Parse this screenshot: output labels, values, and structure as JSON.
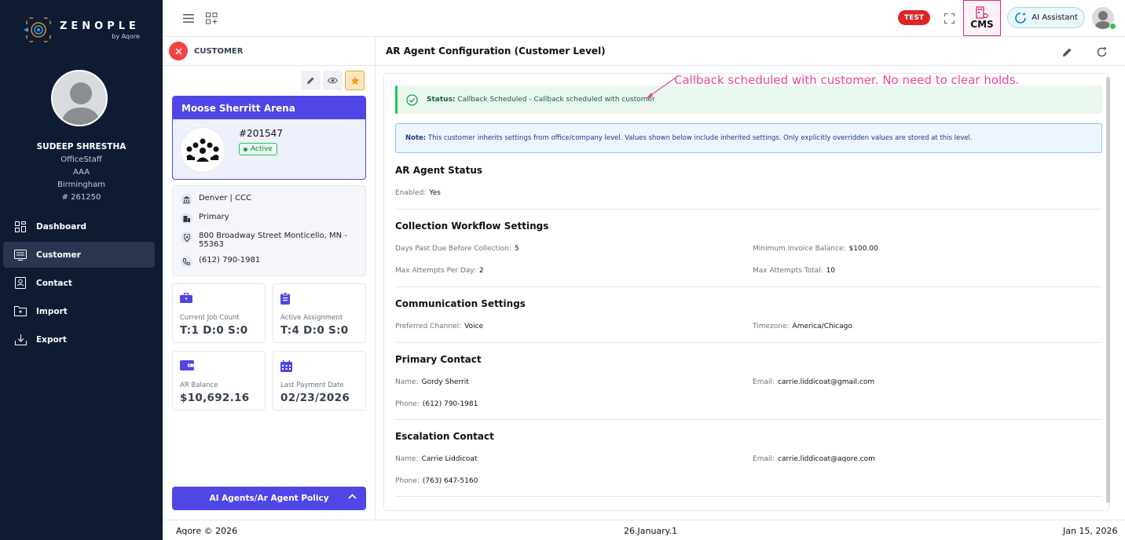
{
  "brand": {
    "name": "ZENOPLE",
    "sub": "by Aqore"
  },
  "user": {
    "name": "SUDEEP SHRESTHA",
    "role": "OfficeStaff",
    "group": "AAA",
    "location": "Birmingham",
    "id": "# 261250"
  },
  "nav": {
    "items": [
      {
        "label": "Dashboard",
        "icon": "dashboard-icon"
      },
      {
        "label": "Customer",
        "icon": "customer-icon",
        "active": true
      },
      {
        "label": "Contact",
        "icon": "contact-icon"
      },
      {
        "label": "Import",
        "icon": "import-icon"
      },
      {
        "label": "Export",
        "icon": "export-icon"
      }
    ]
  },
  "topbar": {
    "test_label": "TEST",
    "cms_label": "CMS",
    "ai_label": "AI Assistant"
  },
  "customer": {
    "header": "CUSTOMER",
    "name": "Moose Sherritt Arena",
    "number": "#201547",
    "status": "Active",
    "office": "Denver | CCC",
    "type": "Primary",
    "address": "800 Broadway Street Monticello, MN - 55363",
    "phone": "(612) 790-1981",
    "stats": [
      {
        "label": "Current Job Count",
        "value": "T:1 D:0 S:0"
      },
      {
        "label": "Active Assignment",
        "value": "T:4 D:0 S:0"
      },
      {
        "label": "AR Balance",
        "value": "$10,692.16"
      },
      {
        "label": "Last Payment Date",
        "value": "02/23/2026"
      }
    ],
    "policy_button": "AI Agents/Ar Agent Policy"
  },
  "main": {
    "title": "AR Agent Configuration (Customer Level)",
    "status_label": "Status:",
    "status_text": "Callback Scheduled - Callback scheduled with customer",
    "note_label": "Note:",
    "note_text": "This customer inherits settings from office/company level. Values shown below include inherited settings. Only explicitly overridden values are stored at this level.",
    "annotation": "Callback scheduled with customer. No need to clear holds.",
    "sections": {
      "agent_status": {
        "title": "AR Agent Status",
        "enabled_label": "Enabled:",
        "enabled_value": "Yes"
      },
      "workflow": {
        "title": "Collection Workflow Settings",
        "days_label": "Days Past Due Before Collection:",
        "days_value": "5",
        "min_label": "Minimum Invoice Balance:",
        "min_value": "$100.00",
        "per_day_label": "Max Attempts Per Day:",
        "per_day_value": "2",
        "total_label": "Max Attempts Total:",
        "total_value": "10"
      },
      "communication": {
        "title": "Communication Settings",
        "channel_label": "Preferred Channel:",
        "channel_value": "Voice",
        "tz_label": "Timezone:",
        "tz_value": "America/Chicago"
      },
      "primary": {
        "title": "Primary Contact",
        "name_label": "Name:",
        "name_value": "Gordy Sherrit",
        "email_label": "Email:",
        "email_value": "carrie.liddicoat@gmail.com",
        "phone_label": "Phone:",
        "phone_value": "(612) 790-1981"
      },
      "escalation": {
        "title": "Escalation Contact",
        "name_label": "Name:",
        "name_value": "Carrie Liddicoat",
        "email_label": "Email:",
        "email_value": "carrie.liddicoat@aqore.com",
        "phone_label": "Phone:",
        "phone_value": "(763) 647-5160"
      }
    }
  },
  "footer": {
    "copyright": "Aqore © 2026",
    "version": "26.January.1",
    "date": "Jan 15, 2026"
  },
  "colors": {
    "sidebar": "#0f1b33",
    "accent": "#4f46e5",
    "success": "#22c55e",
    "danger": "#ef4444",
    "annotation": "#ec4899"
  }
}
